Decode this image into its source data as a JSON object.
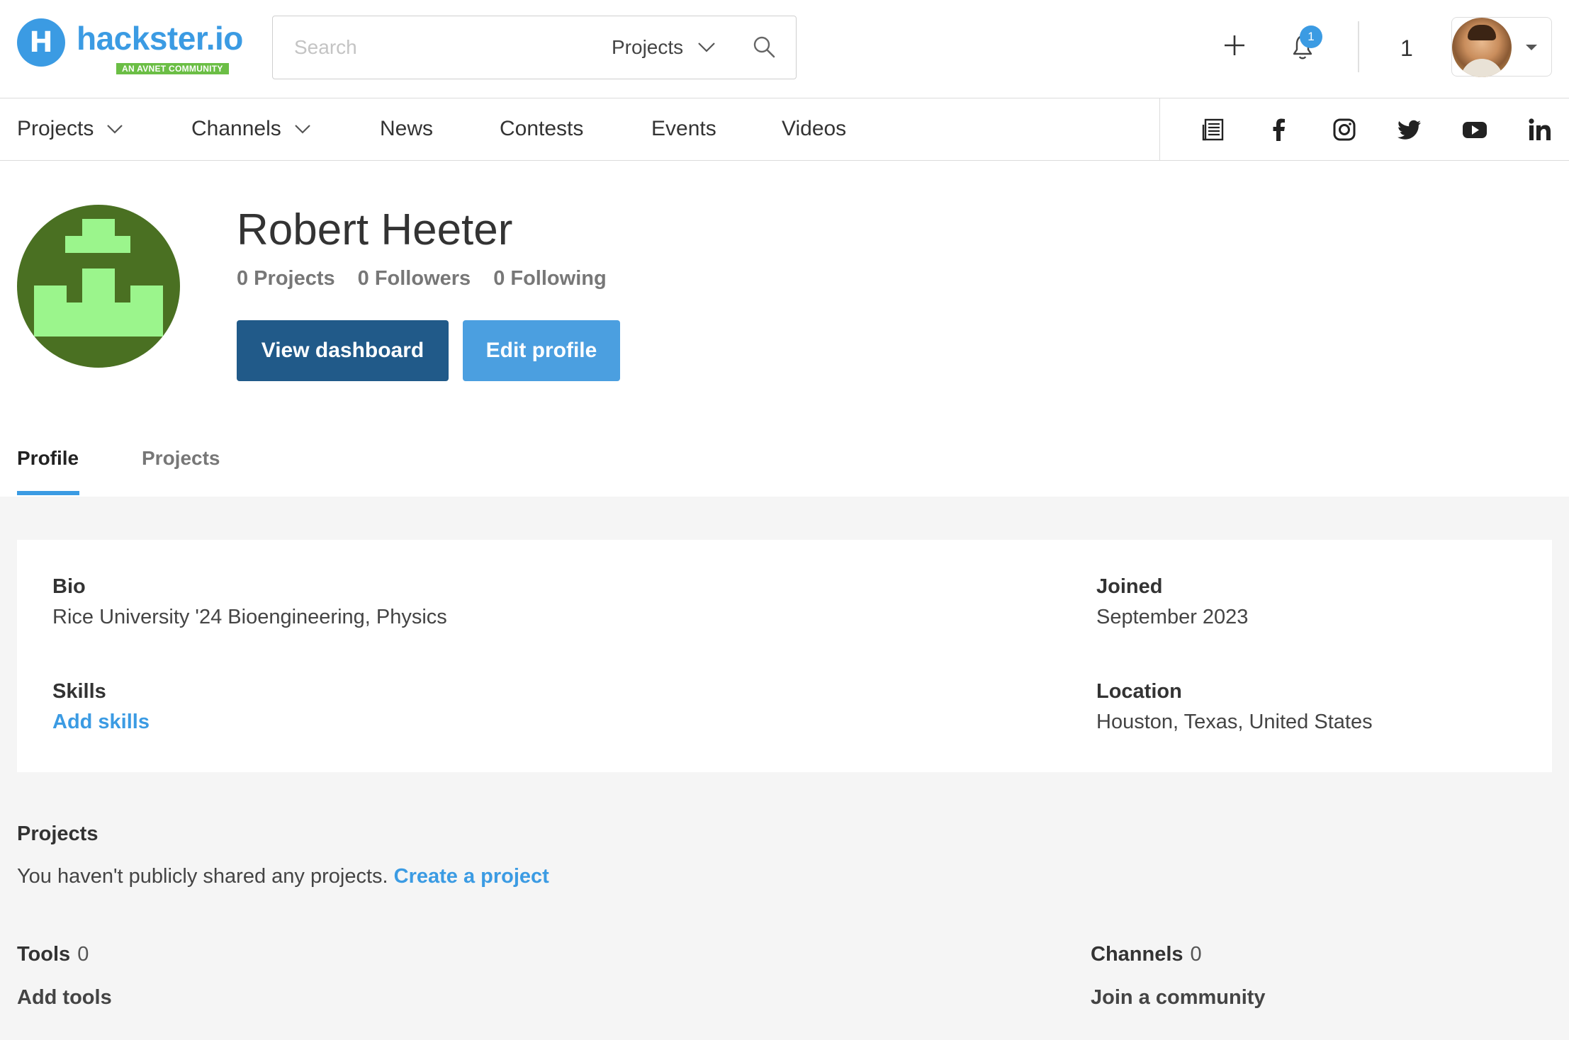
{
  "header": {
    "logo_word": "hackster.io",
    "logo_tag": "AN AVNET COMMUNITY",
    "search": {
      "placeholder": "Search",
      "scope": "Projects"
    },
    "notification_count": "1",
    "counter": "1"
  },
  "nav": {
    "items": [
      "Projects",
      "Channels",
      "News",
      "Contests",
      "Events",
      "Videos"
    ]
  },
  "profile": {
    "name": "Robert Heeter",
    "stats": {
      "projects": "0 Projects",
      "followers": "0 Followers",
      "following": "0 Following"
    },
    "view_dashboard": "View dashboard",
    "edit_profile": "Edit profile",
    "tabs": [
      "Profile",
      "Projects"
    ]
  },
  "info": {
    "bio_label": "Bio",
    "bio": "Rice University '24 Bioengineering, Physics",
    "joined_label": "Joined",
    "joined": "September 2023",
    "skills_label": "Skills",
    "add_skills": "Add skills",
    "location_label": "Location",
    "location": "Houston, Texas, United States"
  },
  "projects_section": {
    "title": "Projects",
    "empty_text": "You haven't publicly shared any projects.",
    "create_link": "Create a project"
  },
  "tools": {
    "title": "Tools",
    "count": "0",
    "link": "Add tools"
  },
  "channels": {
    "title": "Channels",
    "count": "0",
    "link": "Join a community"
  },
  "colors": {
    "brand": "#3b9be3",
    "dark_button": "#215a89",
    "logo_tag": "#6bbe45",
    "avatar_bg": "#4a7022",
    "avatar_fg": "#9bf58c"
  },
  "icons": [
    "search-icon",
    "plus-icon",
    "bell-icon",
    "newsletter-icon",
    "facebook-icon",
    "instagram-icon",
    "twitter-icon",
    "youtube-icon",
    "linkedin-icon"
  ]
}
